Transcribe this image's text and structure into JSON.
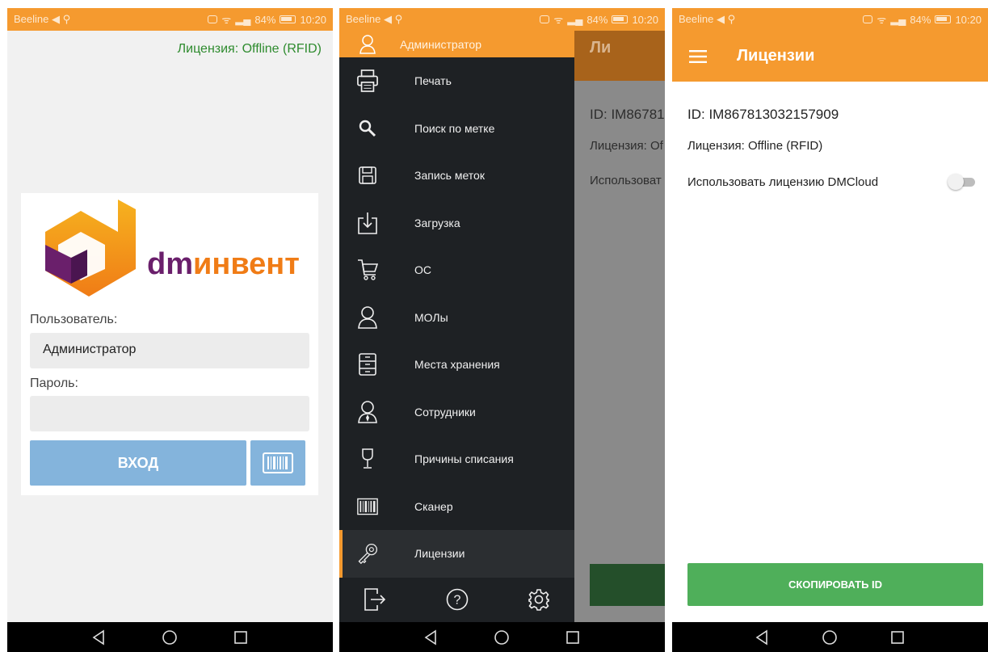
{
  "status_bar": {
    "carrier": "Beeline",
    "battery": "84%",
    "time": "10:20"
  },
  "login_screen": {
    "license": "Лицензия: Offline (RFID)",
    "logo_text": "dmинвент",
    "user_label": "Пользователь:",
    "user_value": "Администратор",
    "password_label": "Пароль:",
    "password_value": "",
    "login_button": "ВХОД",
    "scan_icon": "barcode-icon"
  },
  "drawer": {
    "header_user": "Администратор",
    "items": [
      {
        "label": "Печать",
        "icon": "printer-icon"
      },
      {
        "label": "Поиск по метке",
        "icon": "search-icon"
      },
      {
        "label": "Запись меток",
        "icon": "save-icon"
      },
      {
        "label": "Загрузка",
        "icon": "download-icon"
      },
      {
        "label": "ОС",
        "icon": "cart-icon"
      },
      {
        "label": "МОЛы",
        "icon": "person-icon"
      },
      {
        "label": "Места хранения",
        "icon": "cabinet-icon"
      },
      {
        "label": "Сотрудники",
        "icon": "employee-icon"
      },
      {
        "label": "Причины списания",
        "icon": "glass-icon"
      },
      {
        "label": "Сканер",
        "icon": "barcode-icon"
      },
      {
        "label": "Лицензии",
        "icon": "key-icon"
      }
    ],
    "active_index": 10,
    "footer_icons": [
      "logout-icon",
      "help-icon",
      "gear-icon"
    ],
    "background_fragments": {
      "title": "Ли",
      "id": "ID: IM86781",
      "license": "Лицензия: Of",
      "use": "Использоват"
    }
  },
  "licenses_screen": {
    "title": "Лицензии",
    "id_text": "ID: IM867813032157909",
    "license_text": "Лицензия: Offline (RFID)",
    "use_dmcloud": "Использовать лицензию DMCloud",
    "toggle_on": false,
    "copy_button": "СКОПИРОВАТЬ ID"
  },
  "colors": {
    "accent_orange": "#f59a2f",
    "license_green": "#2e8b2e",
    "login_blue": "#84b4dc",
    "copy_green": "#4faf5a",
    "drawer_dark": "#1e2124"
  }
}
